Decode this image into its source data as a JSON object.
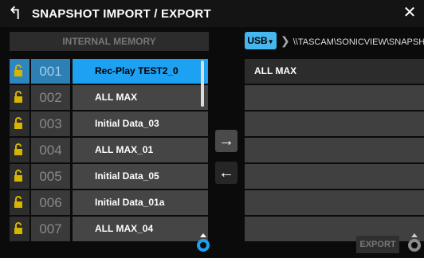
{
  "window": {
    "title": "SNAPSHOT IMPORT / EXPORT"
  },
  "left": {
    "header": "INTERNAL MEMORY",
    "rows": [
      {
        "num": "001",
        "name": "Rec-Play TEST2_0"
      },
      {
        "num": "002",
        "name": "ALL MAX"
      },
      {
        "num": "003",
        "name": "Initial Data_03"
      },
      {
        "num": "004",
        "name": "ALL MAX_01"
      },
      {
        "num": "005",
        "name": "Initial Data_05"
      },
      {
        "num": "006",
        "name": "Initial Data_01a"
      },
      {
        "num": "007",
        "name": "ALL MAX_04"
      }
    ]
  },
  "right": {
    "device": "USB",
    "path": "\\\\TASCAM\\SONICVIEW\\SNAPSHOT\\",
    "rows": [
      "ALL MAX",
      "",
      "",
      "",
      "",
      "",
      ""
    ]
  },
  "buttons": {
    "export": "EXPORT"
  },
  "colors": {
    "accent": "#1da1f2",
    "usb": "#46b6ee",
    "lock": "#d6b400"
  }
}
